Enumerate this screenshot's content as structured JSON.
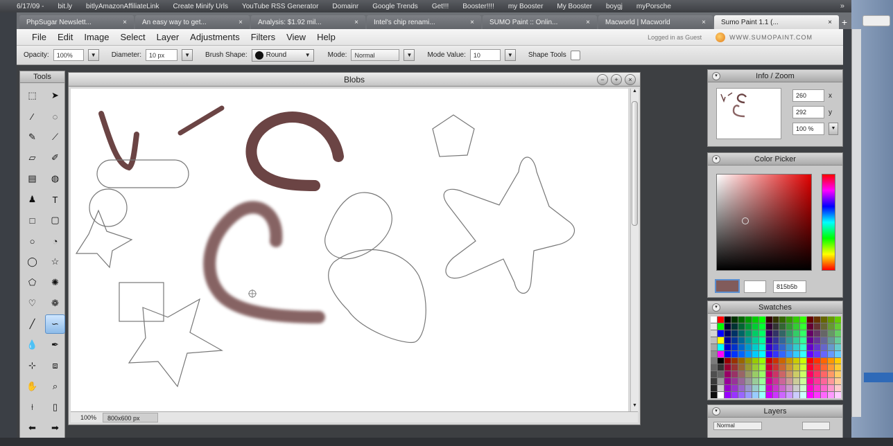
{
  "browser": {
    "bookmarks": [
      "6/17/09 -",
      "bit.ly",
      "bitlyAmazonAffiliateLink",
      "Create Minify Urls",
      "YouTube RSS Generator",
      "Domainr",
      "Google Trends",
      "Get!!!",
      "Booster!!!!",
      "my Booster",
      "My Booster",
      "boygj",
      "myPorsche"
    ],
    "more": "»",
    "tabs": [
      "PhpSugar Newslett...",
      "An easy way to get...",
      "Analysis: $1.92 mil...",
      "Intel's chip renami...",
      "SUMO Paint :: Onlin...",
      "Macworld | Macworld",
      "Sumo Paint 1.1 (..."
    ],
    "tab_close": "×",
    "tab_add": "+"
  },
  "menubar": {
    "items": [
      "File",
      "Edit",
      "Image",
      "Select",
      "Layer",
      "Adjustments",
      "Filters",
      "View",
      "Help"
    ],
    "logged_in": "Logged in as Guest",
    "brand": "WWW.SUMOPAINT.COM"
  },
  "options": {
    "opacity_label": "Opacity:",
    "opacity_value": "100%",
    "diameter_label": "Diameter:",
    "diameter_value": "10 px",
    "brush_shape_label": "Brush Shape:",
    "brush_shape_value": "Round",
    "mode_label": "Mode:",
    "mode_value": "Normal",
    "mode_value_label": "Mode Value:",
    "mode_value_value": "10",
    "shape_tools_label": "Shape Tools"
  },
  "tools": {
    "title": "Tools",
    "items": [
      {
        "icon": "marquee-icon",
        "glyph": "⬚"
      },
      {
        "icon": "move-icon",
        "glyph": "➤"
      },
      {
        "icon": "magic-wand-icon",
        "glyph": "⁄"
      },
      {
        "icon": "lasso-icon",
        "glyph": "◌"
      },
      {
        "icon": "pencil-icon",
        "glyph": "✎"
      },
      {
        "icon": "brush-icon",
        "glyph": "⟋"
      },
      {
        "icon": "eraser-icon",
        "glyph": "▱"
      },
      {
        "icon": "smudge-icon",
        "glyph": "✐"
      },
      {
        "icon": "gradient-icon",
        "glyph": "▤"
      },
      {
        "icon": "paint-bucket-icon",
        "glyph": "◍"
      },
      {
        "icon": "stamp-icon",
        "glyph": "♟"
      },
      {
        "icon": "text-icon",
        "glyph": "T"
      },
      {
        "icon": "rectangle-icon",
        "glyph": "□"
      },
      {
        "icon": "rounded-rect-icon",
        "glyph": "▢"
      },
      {
        "icon": "ellipse-icon",
        "glyph": "○"
      },
      {
        "icon": "pie-icon",
        "glyph": "◔"
      },
      {
        "icon": "circle-icon",
        "glyph": "◯"
      },
      {
        "icon": "star-icon",
        "glyph": "☆"
      },
      {
        "icon": "polygon-icon",
        "glyph": "⬠"
      },
      {
        "icon": "burst-icon",
        "glyph": "✺"
      },
      {
        "icon": "heart-icon",
        "glyph": "♡"
      },
      {
        "icon": "flower-icon",
        "glyph": "❁"
      },
      {
        "icon": "line-icon",
        "glyph": "╱"
      },
      {
        "icon": "blob-brush-icon",
        "glyph": "∽"
      },
      {
        "icon": "drop-icon",
        "glyph": "💧"
      },
      {
        "icon": "pen-icon",
        "glyph": "✒"
      },
      {
        "icon": "crop-icon",
        "glyph": "⊹"
      },
      {
        "icon": "transform-icon",
        "glyph": "⧈"
      },
      {
        "icon": "hand-icon",
        "glyph": "✋"
      },
      {
        "icon": "zoom-icon",
        "glyph": "⌕"
      },
      {
        "icon": "eyedropper-icon",
        "glyph": "⟊"
      },
      {
        "icon": "rect-select-icon",
        "glyph": "▯"
      },
      {
        "icon": "arrow-left-icon",
        "glyph": "⬅"
      },
      {
        "icon": "arrow-right-icon",
        "glyph": "➡"
      }
    ],
    "selected_index": 23
  },
  "document": {
    "title": "Blobs",
    "zoom": "100%",
    "size": "800x600 px"
  },
  "info_zoom": {
    "title": "Info / Zoom",
    "x_value": "260",
    "x_label": "x",
    "y_value": "292",
    "y_label": "y",
    "zoom_value": "100 %"
  },
  "color_picker": {
    "title": "Color Picker",
    "foreground": "#815b5b",
    "background": "#ffffff",
    "hex_value": "815b5b"
  },
  "swatches": {
    "title": "Swatches"
  },
  "layers": {
    "title": "Layers",
    "blend": "Normal"
  },
  "colors": {
    "stroke": "#6b4444",
    "soft_stroke": "#7a5252"
  }
}
